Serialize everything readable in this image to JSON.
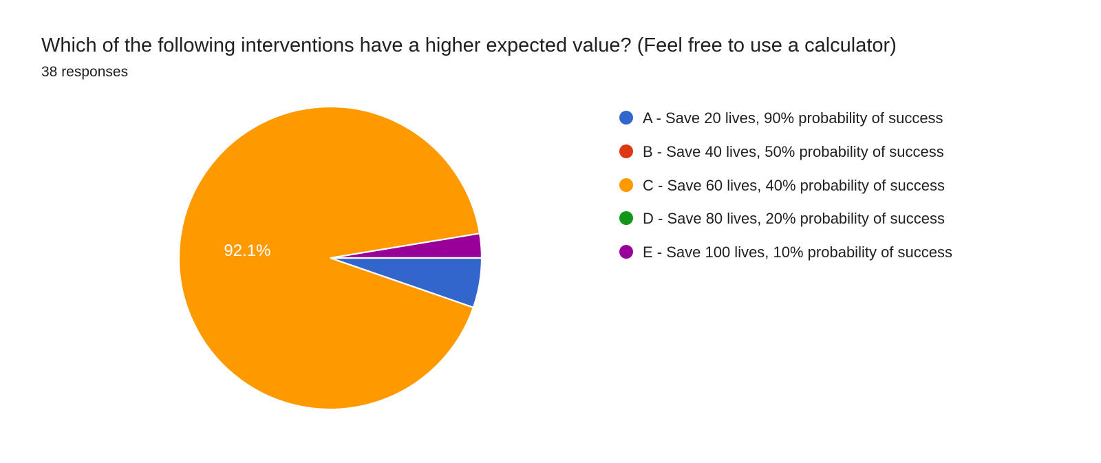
{
  "title": "Which of the following interventions have a higher expected value? (Feel free to use a calculator)",
  "responses_label": "38 responses",
  "chart_data": {
    "type": "pie",
    "title": "Which of the following interventions have a higher expected value? (Feel free to use a calculator)",
    "total_responses": 38,
    "series": [
      {
        "name": "A - Save 20 lives, 90% probability of success",
        "value_pct": 5.3,
        "color": "#3366cc"
      },
      {
        "name": "B - Save 40 lives, 50% probability of success",
        "value_pct": 0.0,
        "color": "#dc3912"
      },
      {
        "name": "C - Save 60 lives, 40% probability of success",
        "value_pct": 92.1,
        "color": "#ff9900"
      },
      {
        "name": "D - Save 80 lives, 20% probability of success",
        "value_pct": 0.0,
        "color": "#109618"
      },
      {
        "name": "E - Save 100 lives, 10% probability of success",
        "value_pct": 2.6,
        "color": "#990099"
      }
    ],
    "visible_labels": [
      {
        "text": "92.1%",
        "for": "C"
      }
    ]
  },
  "legend": {
    "items": [
      {
        "label": "A - Save 20 lives, 90% probability of success",
        "color": "#3366cc"
      },
      {
        "label": "B - Save 40 lives, 50% probability of success",
        "color": "#dc3912"
      },
      {
        "label": "C - Save 60 lives, 40% probability of success",
        "color": "#ff9900"
      },
      {
        "label": "D - Save 80 lives, 20% probability of success",
        "color": "#109618"
      },
      {
        "label": "E - Save 100 lives, 10% probability of success",
        "color": "#990099"
      }
    ]
  },
  "pie_label_main": "92.1%"
}
